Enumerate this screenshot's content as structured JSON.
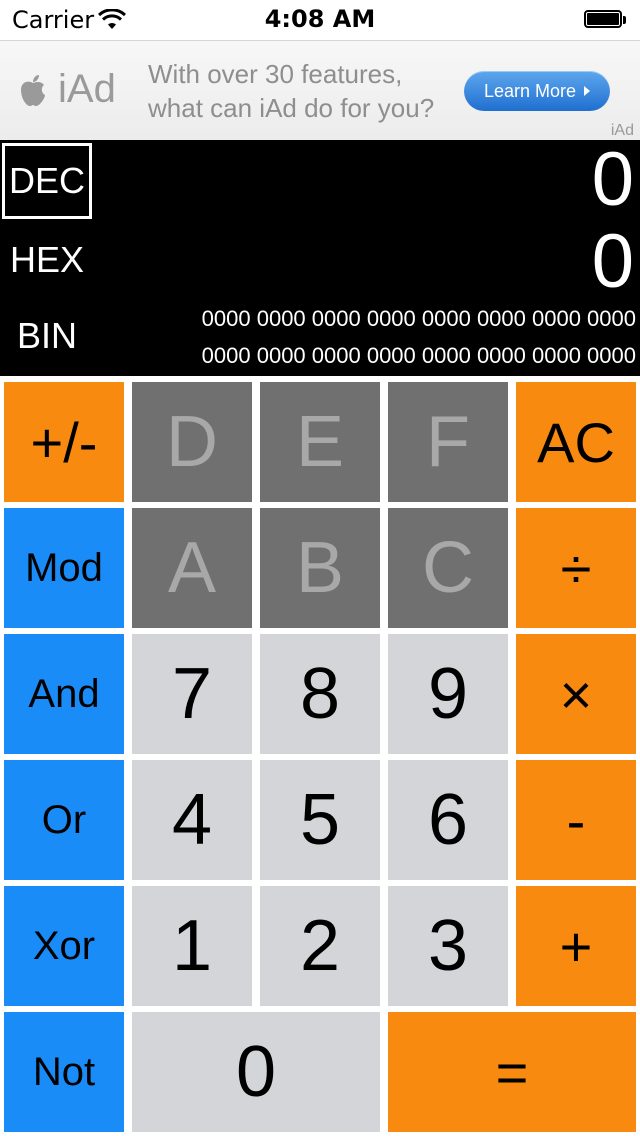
{
  "status_bar": {
    "carrier": "Carrier",
    "time": "4:08 AM"
  },
  "ad": {
    "logo_text": "iAd",
    "message_line1": "With over 30 features,",
    "message_line2": "what can iAd do for you?",
    "button_label": "Learn More",
    "corner_label": "iAd"
  },
  "display": {
    "dec_label": "DEC",
    "hex_label": "HEX",
    "bin_label": "BIN",
    "dec_value": "0",
    "hex_value": "0",
    "bin_row1": "0000 0000 0000 0000 0000 0000 0000 0000",
    "bin_row2": "0000 0000 0000 0000 0000 0000 0000 0000"
  },
  "keys": {
    "sign": "+/-",
    "d": "D",
    "e": "E",
    "f": "F",
    "clear": "AC",
    "mod": "Mod",
    "a": "A",
    "b": "B",
    "c": "C",
    "divide": "÷",
    "and": "And",
    "k7": "7",
    "k8": "8",
    "k9": "9",
    "multiply": "×",
    "or": "Or",
    "k4": "4",
    "k5": "5",
    "k6": "6",
    "minus": "-",
    "xor": "Xor",
    "k1": "1",
    "k2": "2",
    "k3": "3",
    "plus": "+",
    "not": "Not",
    "k0": "0",
    "equals": "="
  },
  "colors": {
    "orange": "#f88a0f",
    "blue": "#1a8cf8",
    "dark_gray": "#707070",
    "light_gray": "#d4d5d8"
  }
}
